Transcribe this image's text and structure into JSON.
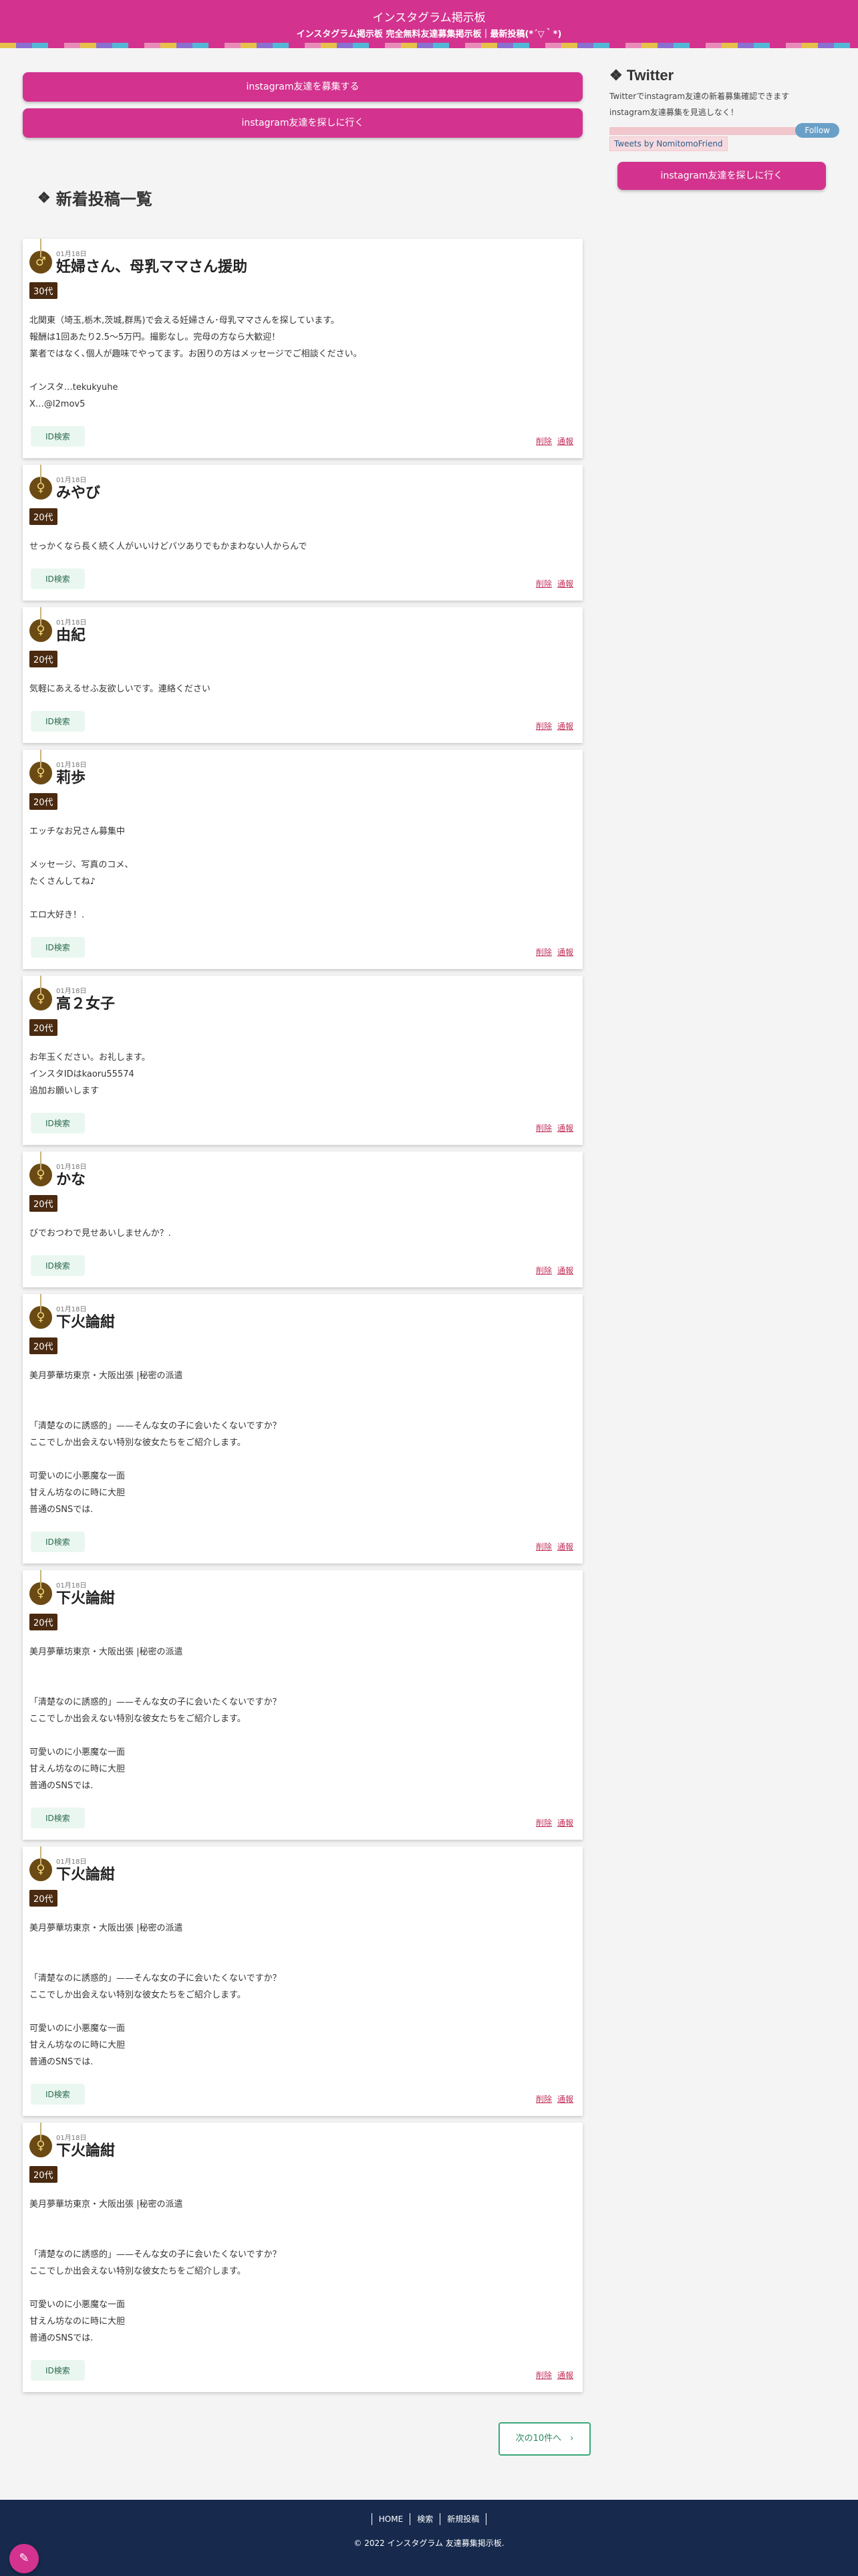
{
  "header": {
    "title": "インスタグラム掲示板",
    "subtitle": "インスタグラム掲示板 完全無料友達募集掲示板｜最新投稿(*´▽｀*)"
  },
  "actions": {
    "recruit_label": "instagram友達を募集する",
    "find_label": "instagram友達を探しに行く"
  },
  "section": {
    "title": "新着投稿一覧",
    "icon": "diamond-icon"
  },
  "posts": [
    {
      "gender": "♂",
      "date": "01月18日",
      "title": "妊婦さん、母乳ママさん援助",
      "age": "30代",
      "body": "北関東（埼玉,栃木,茨城,群馬)で会える妊婦さん･母乳ママさんを探しています。\n報酬は1回あたり2.5〜5万円。撮影なし。完母の方なら大歓迎！\n業者ではなく､個人が趣味でやってます。お困りの方はメッセージでご相談ください。\n\nインスタ…tekukyuhe\nX…@l2mov5",
      "id_label": "ID検索",
      "delete_label": "削除",
      "report_label": "通報"
    },
    {
      "gender": "♀",
      "date": "01月18日",
      "title": "みやび",
      "age": "20代",
      "body": "せっかくなら長く続く人がいいけどバツありでもかまわない人からんで",
      "id_label": "ID検索",
      "delete_label": "削除",
      "report_label": "通報"
    },
    {
      "gender": "♀",
      "date": "01月18日",
      "title": "由紀",
      "age": "20代",
      "body": "気軽にあえるせふ友欲しいです。連絡ください",
      "id_label": "ID検索",
      "delete_label": "削除",
      "report_label": "通報"
    },
    {
      "gender": "♀",
      "date": "01月18日",
      "title": "莉歩",
      "age": "20代",
      "body": "エッチなお兄さん募集中\n\nメッセージ、写真のコメ、\nたくさんしてね♪\n\nエロ大好き！.",
      "id_label": "ID検索",
      "delete_label": "削除",
      "report_label": "通報"
    },
    {
      "gender": "♀",
      "date": "01月18日",
      "title": "高２女子",
      "age": "20代",
      "body": "お年玉ください。お礼します。\nインスタIDはkaoru55574\n追加お願いします",
      "id_label": "ID検索",
      "delete_label": "削除",
      "report_label": "通報"
    },
    {
      "gender": "♀",
      "date": "01月18日",
      "title": "かな",
      "age": "20代",
      "body": "びでおつわで見せあいしませんか？.",
      "id_label": "ID検索",
      "delete_label": "削除",
      "report_label": "通報"
    },
    {
      "gender": "♀",
      "date": "01月18日",
      "title": "下火論紺",
      "age": "20代",
      "body": "美月夢華坊東京・大阪出張 |秘密の派遣\n\n\n「清楚なのに誘惑的」——そんな女の子に会いたくないですか？\nここでしか出会えない特別な彼女たちをご紹介します。\n\n可愛いのに小悪魔な一面\n甘えん坊なのに時に大胆\n普通のSNSでは.",
      "id_label": "ID検索",
      "delete_label": "削除",
      "report_label": "通報"
    },
    {
      "gender": "♀",
      "date": "01月18日",
      "title": "下火論紺",
      "age": "20代",
      "body": "美月夢華坊東京・大阪出張 |秘密の派遣\n\n\n「清楚なのに誘惑的」——そんな女の子に会いたくないですか？\nここでしか出会えない特別な彼女たちをご紹介します。\n\n可愛いのに小悪魔な一面\n甘えん坊なのに時に大胆\n普通のSNSでは.",
      "id_label": "ID検索",
      "delete_label": "削除",
      "report_label": "通報"
    },
    {
      "gender": "♀",
      "date": "01月18日",
      "title": "下火論紺",
      "age": "20代",
      "body": "美月夢華坊東京・大阪出張 |秘密の派遣\n\n\n「清楚なのに誘惑的」——そんな女の子に会いたくないですか？\nここでしか出会えない特別な彼女たちをご紹介します。\n\n可愛いのに小悪魔な一面\n甘えん坊なのに時に大胆\n普通のSNSでは.",
      "id_label": "ID検索",
      "delete_label": "削除",
      "report_label": "通報"
    },
    {
      "gender": "♀",
      "date": "01月18日",
      "title": "下火論紺",
      "age": "20代",
      "body": "美月夢華坊東京・大阪出張 |秘密の派遣\n\n\n「清楚なのに誘惑的」——そんな女の子に会いたくないですか？\nここでしか出会えない特別な彼女たちをご紹介します。\n\n可愛いのに小悪魔な一面\n甘えん坊なのに時に大胆\n普通のSNSでは.",
      "id_label": "ID検索",
      "delete_label": "削除",
      "report_label": "通報"
    }
  ],
  "pagination": {
    "next_label": "次の10件へ　›"
  },
  "sidebar": {
    "title": "Twitter",
    "text": "Twitterでinstagram友達の新着募集確認できます\ninstagram友達募集を見逃しなく！",
    "follow_label": "Follow",
    "tweets_label": "Tweets by NomitomoFriend",
    "button_label": "instagram友達を探しに行く"
  },
  "footer": {
    "nav": [
      "HOME",
      "検索",
      "新規投稿"
    ],
    "copyright": "© 2022 インスタグラム 友達募集掲示板."
  },
  "colors": {
    "primary": "#d3338f",
    "footer": "#172a4d",
    "icon_bg": "#6b4a14",
    "age_bg": "#4a2a10"
  }
}
